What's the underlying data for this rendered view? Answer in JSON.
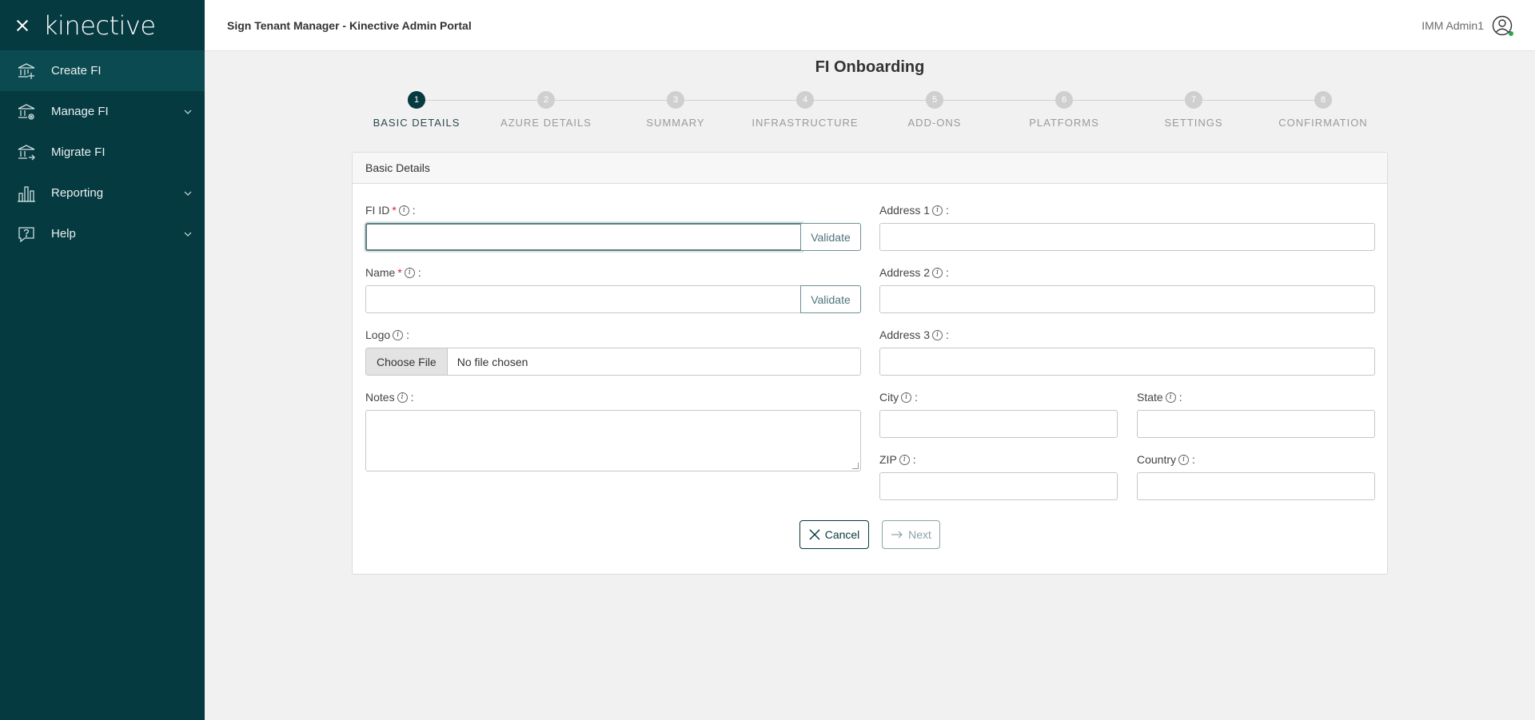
{
  "sidebar": {
    "logo": "kinective",
    "items": [
      {
        "label": "Create FI",
        "icon": "bank-add-icon",
        "active": true
      },
      {
        "label": "Manage FI",
        "icon": "bank-settings-icon",
        "expandable": true
      },
      {
        "label": "Migrate FI",
        "icon": "bank-migrate-icon"
      },
      {
        "label": "Reporting",
        "icon": "bar-chart-icon",
        "expandable": true
      },
      {
        "label": "Help",
        "icon": "help-icon",
        "expandable": true
      }
    ]
  },
  "header": {
    "title": "Sign Tenant Manager - Kinective Admin Portal",
    "user": "IMM Admin1"
  },
  "page": {
    "title": "FI Onboarding"
  },
  "stepper": {
    "steps": [
      {
        "num": "1",
        "label": "BASIC DETAILS",
        "active": true
      },
      {
        "num": "2",
        "label": "AZURE DETAILS"
      },
      {
        "num": "3",
        "label": "SUMMARY"
      },
      {
        "num": "4",
        "label": "INFRASTRUCTURE"
      },
      {
        "num": "5",
        "label": "ADD-ONS"
      },
      {
        "num": "6",
        "label": "PLATFORMS"
      },
      {
        "num": "7",
        "label": "SETTINGS"
      },
      {
        "num": "8",
        "label": "CONFIRMATION"
      }
    ]
  },
  "form": {
    "section_title": "Basic Details",
    "fi_id_label": "FI ID",
    "name_label": "Name",
    "logo_label": "Logo",
    "notes_label": "Notes",
    "address1_label": "Address 1",
    "address2_label": "Address 2",
    "address3_label": "Address 3",
    "city_label": "City",
    "state_label": "State",
    "zip_label": "ZIP",
    "country_label": "Country",
    "required_mark": "*",
    "colon": ":",
    "info_glyph": "i",
    "validate_label": "Validate",
    "choose_file_label": "Choose File",
    "no_file_text": "No file chosen",
    "cancel_label": "Cancel",
    "next_label": "Next"
  }
}
